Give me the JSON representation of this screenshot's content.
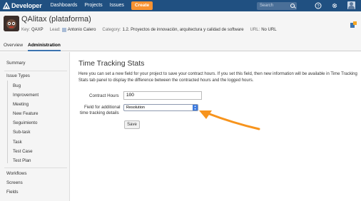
{
  "topbar": {
    "brand": "Developer",
    "nav": [
      "Dashboards",
      "Projects",
      "Issues"
    ],
    "create_label": "Create",
    "search_placeholder": "Search",
    "icons": [
      "help-icon",
      "gear-icon",
      "user-avatar"
    ]
  },
  "project": {
    "title": "QAlitax (plataforma)",
    "key_label": "Key:",
    "key_value": "QAXP",
    "lead_label": "Lead:",
    "lead_value": "Antonio Calero",
    "category_label": "Category:",
    "category_value": "1.2. Proyectos de innovación, arquitectura y calidad de software",
    "url_label": "URL:",
    "url_value": "No URL"
  },
  "tabs": [
    "Overview",
    "Administration"
  ],
  "sidebar": {
    "summary": "Summary",
    "issue_types": "Issue Types",
    "issue_type_items": [
      "Bug",
      "Improvement",
      "Meeting",
      "New Feature",
      "Seguimiento",
      "Sub-task",
      "Task",
      "Test Case",
      "Test Plan"
    ],
    "workflows": "Workflows",
    "screens": "Screens",
    "fields": "Fields"
  },
  "main": {
    "heading": "Time Tracking Stats",
    "description": "Here you can set a new field for your project to save your contract hours. If you set this field, then new information will be available in Time Tracking Stats tab panel to display the difference between the contracted hours and the logged hours.",
    "contract_hours_label": "Contract Hours",
    "contract_hours_value": "100",
    "field_label_line1": "Field for additional",
    "field_label_line2": "time tracking details",
    "field_select_value": "Resolution",
    "save_label": "Save"
  },
  "colors": {
    "topbar": "#205081",
    "create": "#f79232",
    "accent_arrow": "#f7941d",
    "select_caret": "#3d7be0"
  }
}
